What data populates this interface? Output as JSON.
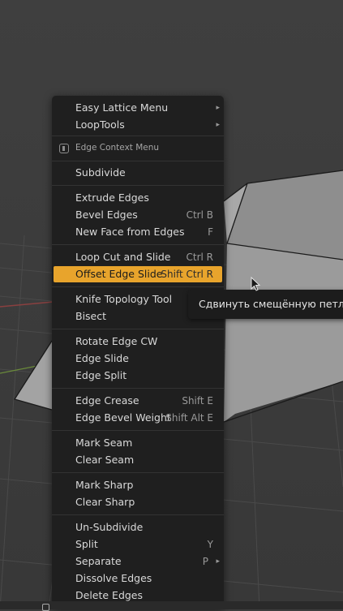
{
  "menu": {
    "items": [
      {
        "id": "easy-lattice",
        "label": "Easy Lattice Menu",
        "shortcut": "",
        "submenu": true
      },
      {
        "id": "looptools",
        "label": "LoopTools",
        "shortcut": "",
        "submenu": true
      },
      {
        "id": "subdivide",
        "label": "Subdivide",
        "shortcut": ""
      },
      {
        "id": "extrude-edges",
        "label": "Extrude Edges",
        "shortcut": ""
      },
      {
        "id": "bevel-edges",
        "label": "Bevel Edges",
        "shortcut": "Ctrl B"
      },
      {
        "id": "new-face",
        "label": "New Face from Edges",
        "shortcut": "F"
      },
      {
        "id": "loop-cut",
        "label": "Loop Cut and Slide",
        "shortcut": "Ctrl R"
      },
      {
        "id": "offset-edge-slide",
        "label": "Offset Edge Slide",
        "shortcut": "Shift Ctrl R",
        "active": true
      },
      {
        "id": "knife-topology",
        "label": "Knife Topology Tool",
        "shortcut": ""
      },
      {
        "id": "bisect",
        "label": "Bisect",
        "shortcut": ""
      },
      {
        "id": "rotate-edge-cw",
        "label": "Rotate Edge CW",
        "shortcut": ""
      },
      {
        "id": "edge-slide",
        "label": "Edge Slide",
        "shortcut": ""
      },
      {
        "id": "edge-split",
        "label": "Edge Split",
        "shortcut": ""
      },
      {
        "id": "edge-crease",
        "label": "Edge Crease",
        "shortcut": "Shift E"
      },
      {
        "id": "edge-bevel-weight",
        "label": "Edge Bevel Weight",
        "shortcut": "Shift Alt E"
      },
      {
        "id": "mark-seam",
        "label": "Mark Seam",
        "shortcut": ""
      },
      {
        "id": "clear-seam",
        "label": "Clear Seam",
        "shortcut": ""
      },
      {
        "id": "mark-sharp",
        "label": "Mark Sharp",
        "shortcut": ""
      },
      {
        "id": "clear-sharp",
        "label": "Clear Sharp",
        "shortcut": ""
      },
      {
        "id": "un-subdivide",
        "label": "Un-Subdivide",
        "shortcut": ""
      },
      {
        "id": "split",
        "label": "Split",
        "shortcut": "Y"
      },
      {
        "id": "separate",
        "label": "Separate",
        "shortcut": "P",
        "submenu": true
      },
      {
        "id": "dissolve-edges",
        "label": "Dissolve Edges",
        "shortcut": ""
      },
      {
        "id": "delete-edges",
        "label": "Delete Edges",
        "shortcut": ""
      }
    ],
    "header": "Edge Context Menu"
  },
  "tooltip": {
    "text": "Сдвинуть смещённую петлю"
  },
  "colors": {
    "accent": "#e8a42c",
    "menu_bg": "#1f1f1f",
    "viewport_bg": "#3d3d3d",
    "mesh_face": "#9a9a9a"
  },
  "icons": {
    "header": "edge-menu-icon",
    "submenu": "chevron-right-icon",
    "cursor": "mouse-pointer-icon"
  }
}
